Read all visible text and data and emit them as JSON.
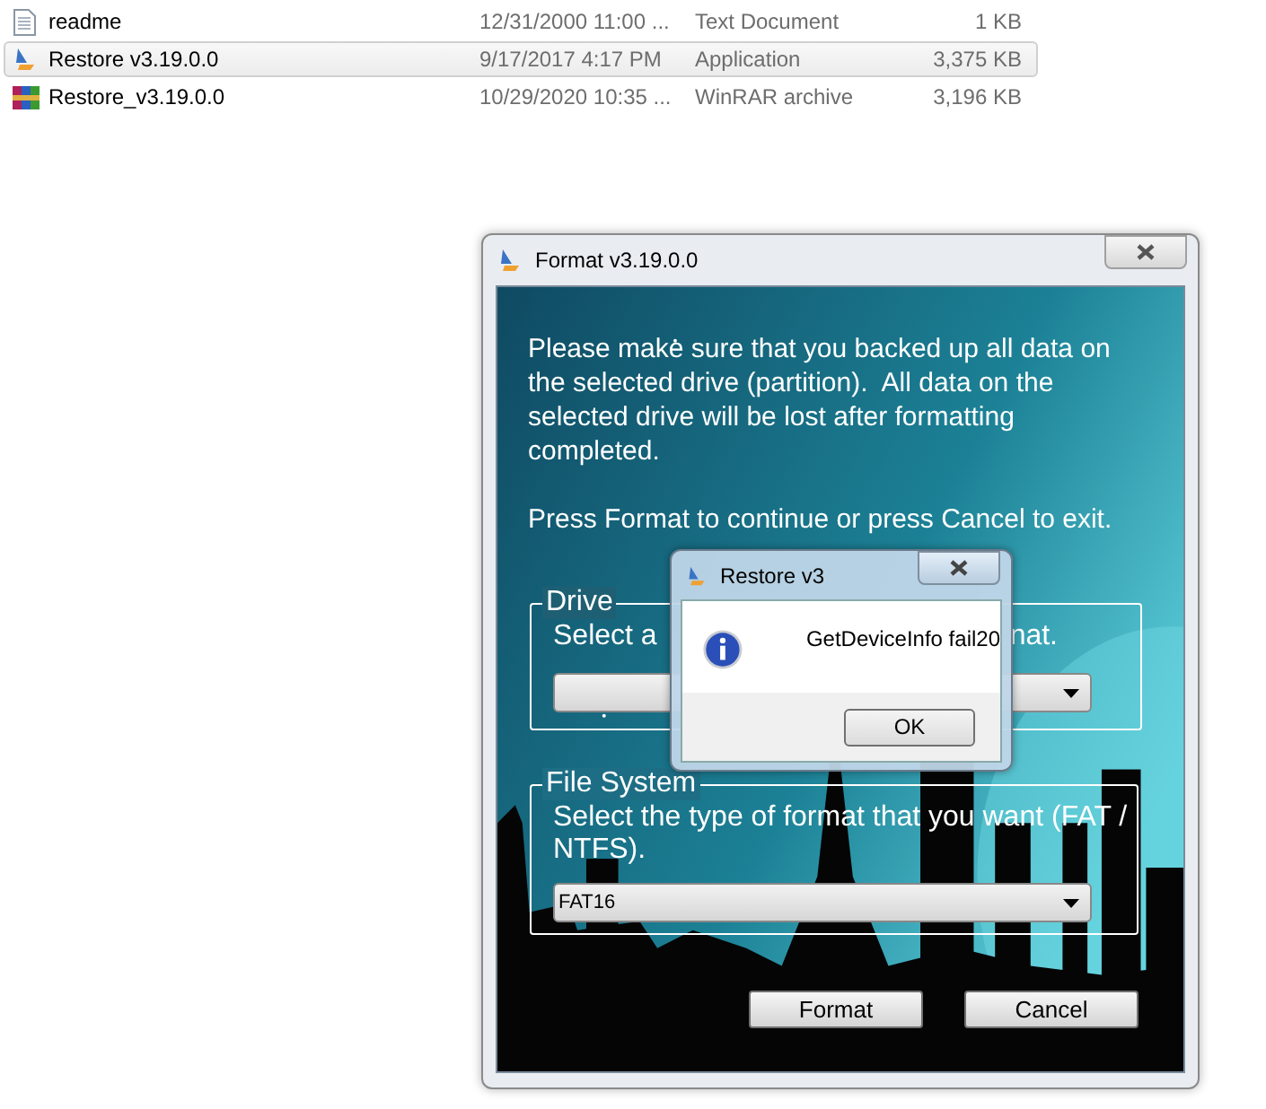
{
  "file_list": {
    "rows": [
      {
        "kind": "text",
        "name": "readme",
        "modified": "12/31/2000 11:00 ...",
        "type": "Text Document",
        "size": "1 KB",
        "selected": false
      },
      {
        "kind": "application",
        "name": "Restore v3.19.0.0",
        "modified": "9/17/2017 4:17 PM",
        "type": "Application",
        "size": "3,375 KB",
        "selected": true
      },
      {
        "kind": "archive",
        "name": "Restore_v3.19.0.0",
        "modified": "10/29/2020 10:35 ...",
        "type": "WinRAR archive",
        "size": "3,196 KB",
        "selected": false
      }
    ]
  },
  "format_window": {
    "title": "Format v3.19.0.0",
    "background": {
      "kind": "picture"
    },
    "warning": "Please make sure that you backed up all data on the selected drive (partition).  All data on the selected drive will be lost after formatting completed.",
    "instruction": "Press Format to continue or press Cancel to exit.",
    "drive_group": {
      "legend": "Drive",
      "hint_parts": [
        "Select a",
        "nat."
      ]
    },
    "file_system_group": {
      "legend": "File System",
      "hint": "Select the type of format that you want (FAT / NTFS).",
      "value": "FAT16"
    },
    "buttons": [
      "Format",
      "Cancel"
    ]
  },
  "message_box": {
    "title": "Restore v3",
    "message": "GetDeviceInfo fail20",
    "button": "OK"
  }
}
